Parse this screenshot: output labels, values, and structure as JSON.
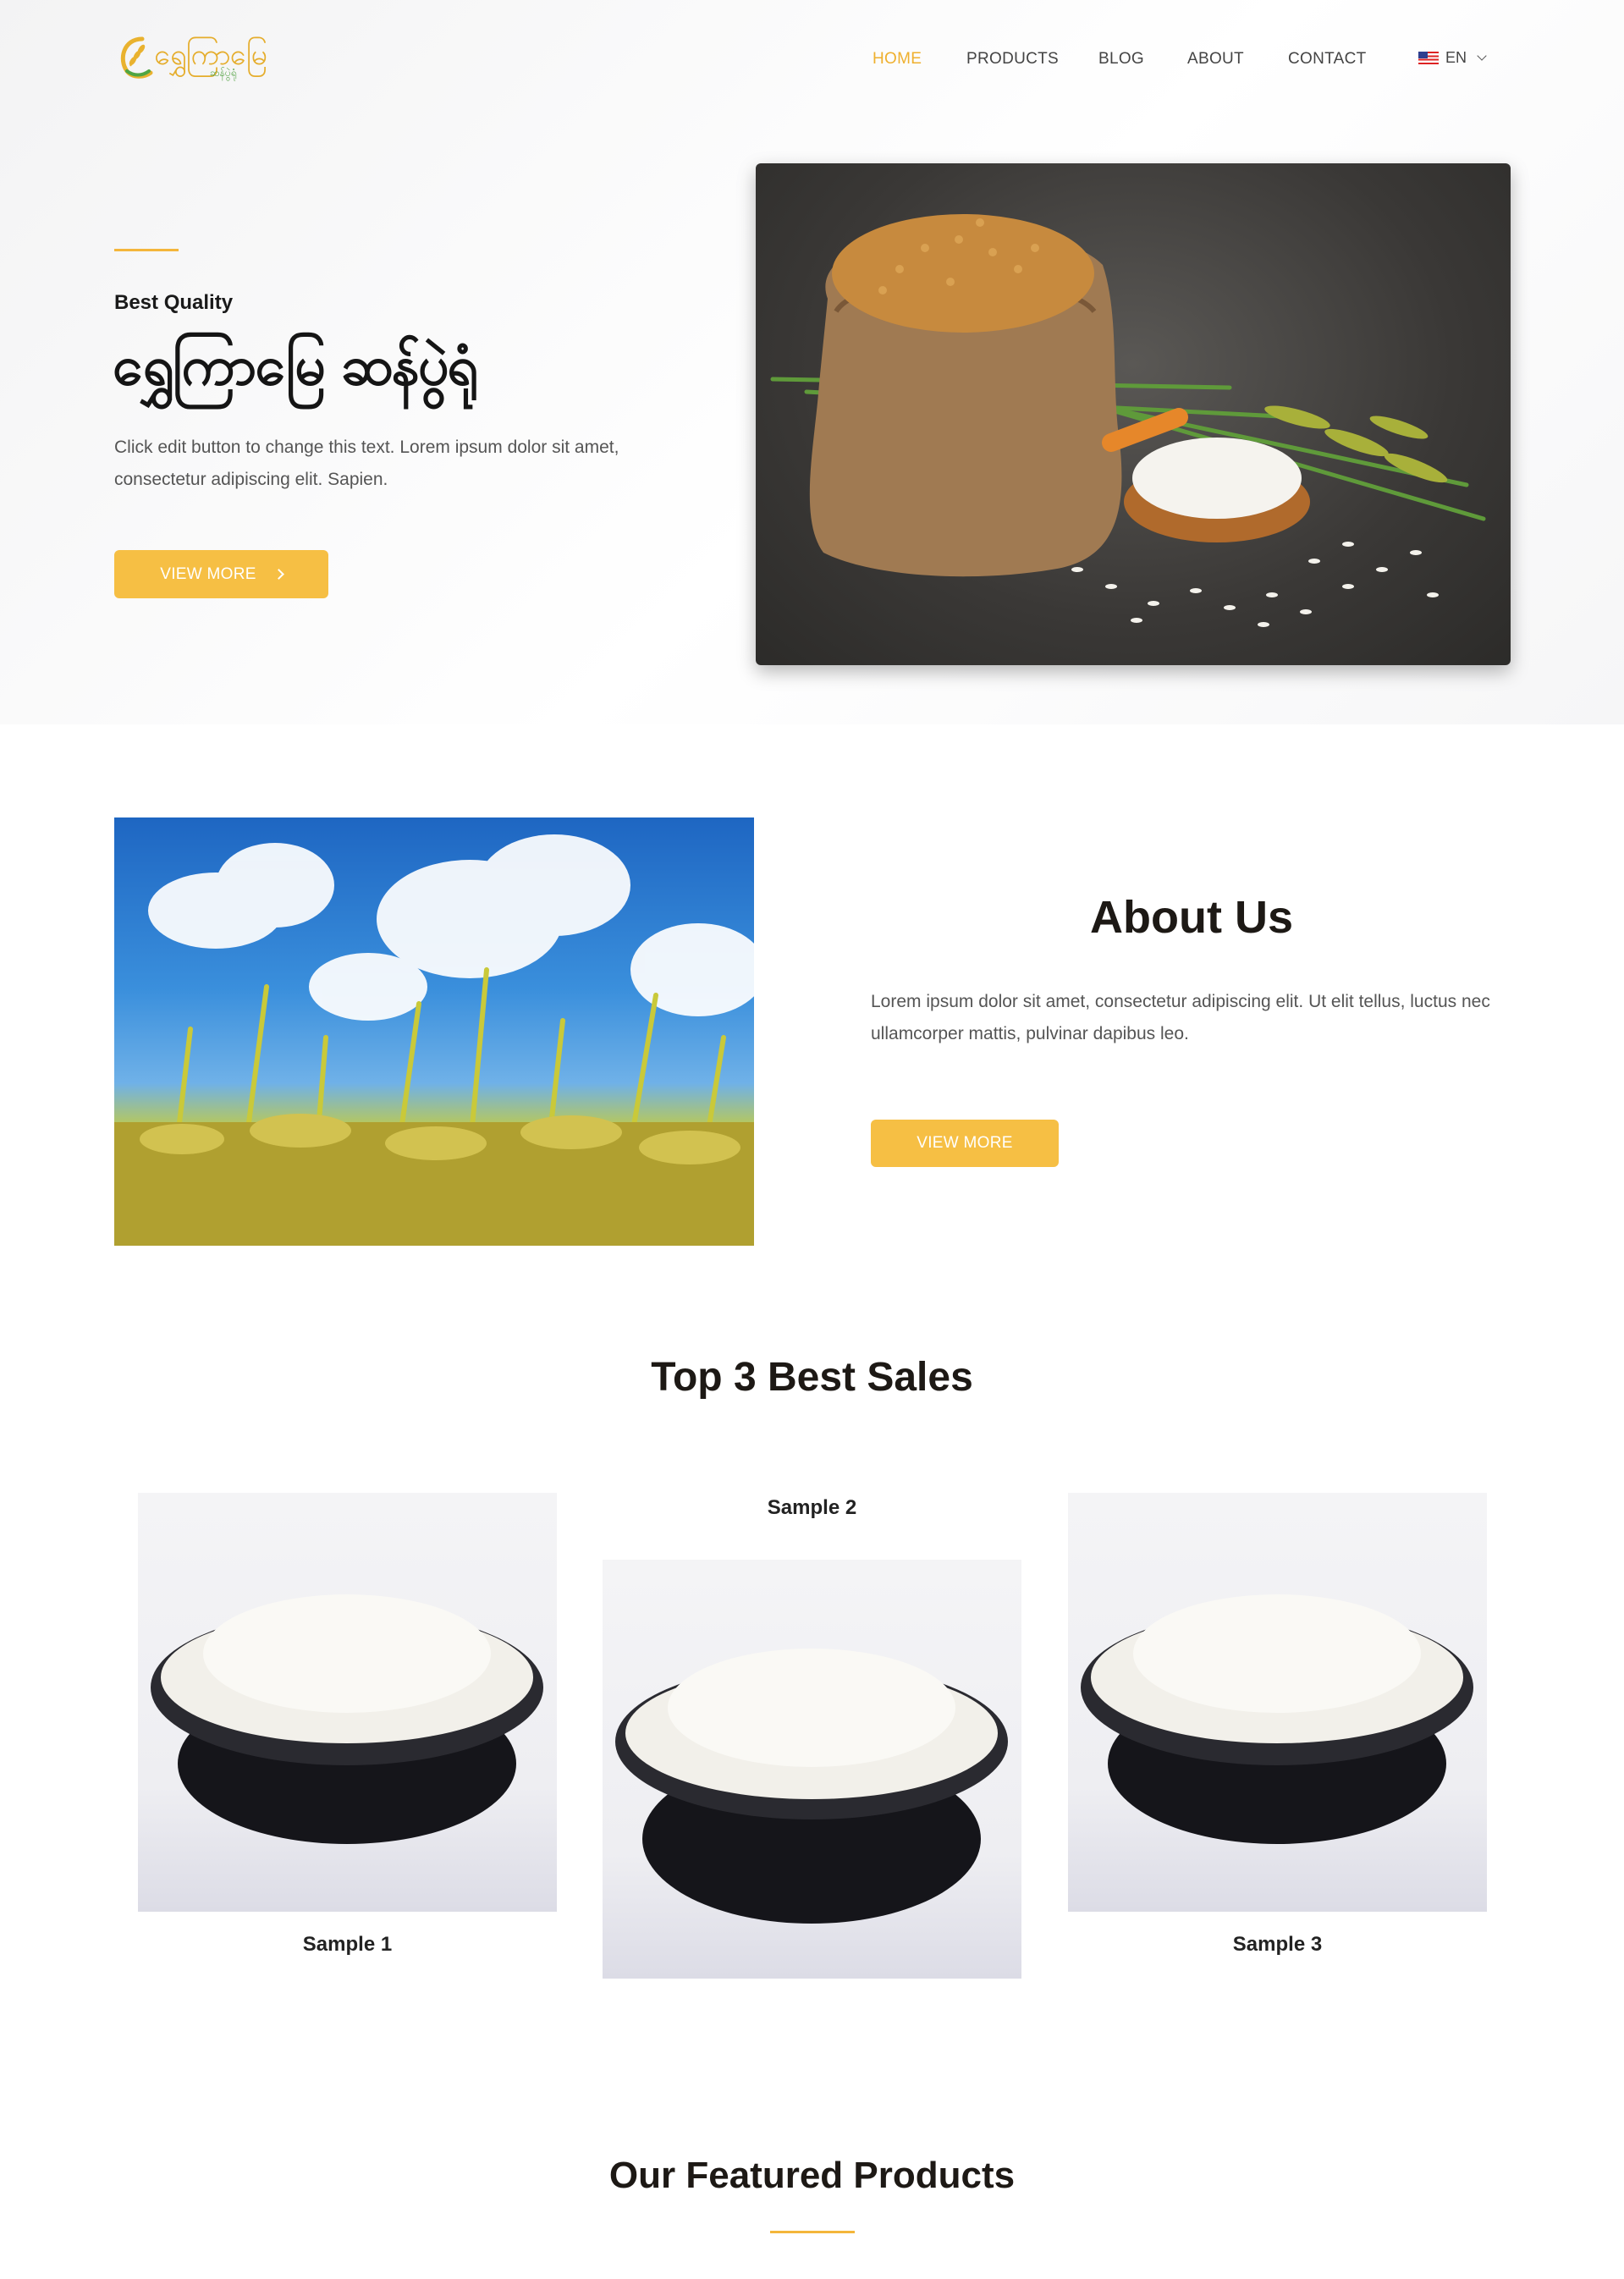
{
  "brand": {
    "logo_text": "ရွှေကြာမြေ",
    "logo_subtext": "ဆန်ပွဲရုံ",
    "accent_color": "#f6bf44",
    "active_nav_color": "#efb02e"
  },
  "nav": {
    "items": [
      {
        "label": "HOME",
        "active": true
      },
      {
        "label": "PRODUCTS",
        "active": false
      },
      {
        "label": "BLOG",
        "active": false
      },
      {
        "label": "ABOUT",
        "active": false
      },
      {
        "label": "CONTACT",
        "active": false
      }
    ],
    "language": {
      "label": "EN",
      "flag_icon": "us-flag-icon"
    }
  },
  "hero": {
    "eyebrow": "Best Quality",
    "title": "ရွှေကြာမြေ ဆန်ပွဲရုံ",
    "description": "Click edit button to change this text. Lorem ipsum dolor sit amet, consectetur adipiscing elit. Sapien.",
    "button_label": "VIEW MORE",
    "image": "rice-sack-photo"
  },
  "about": {
    "title": "About Us",
    "description": "Lorem ipsum dolor sit amet, consectetur adipiscing elit. Ut elit tellus, luctus nec ullamcorper mattis, pulvinar dapibus leo.",
    "button_label": "VIEW MORE",
    "image": "rice-field-photo"
  },
  "top_sales": {
    "title": "Top 3 Best Sales",
    "items": [
      {
        "label": "Sample 1",
        "image": "rice-bowl-photo"
      },
      {
        "label": "Sample 2",
        "image": "rice-bowl-photo"
      },
      {
        "label": "Sample 3",
        "image": "rice-bowl-photo"
      }
    ]
  },
  "featured": {
    "title": "Our Featured Products"
  }
}
